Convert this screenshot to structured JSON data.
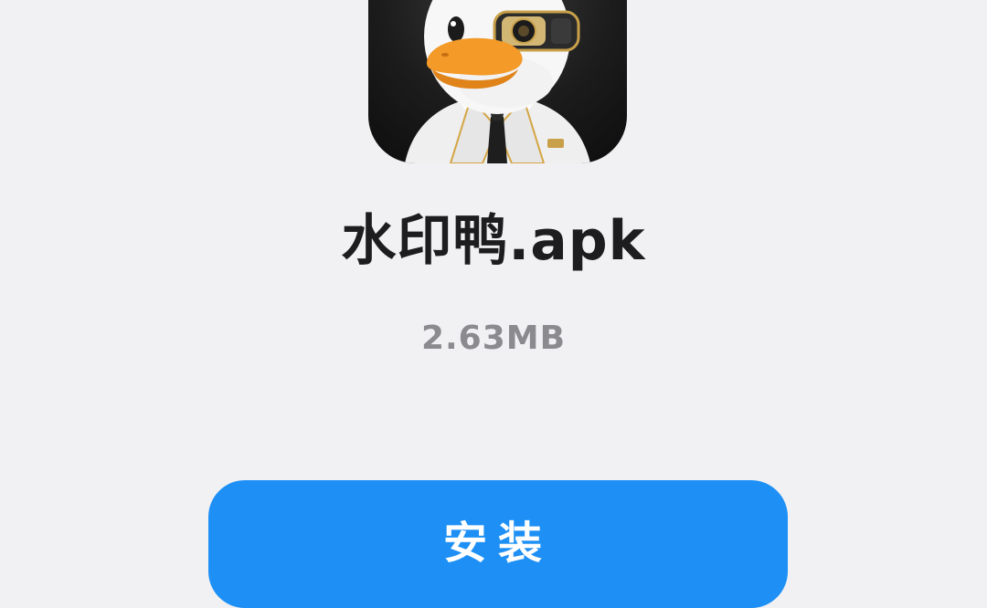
{
  "app": {
    "icon": "duck-app-icon",
    "file_name": "水印鸭.apk",
    "file_size": "2.63MB"
  },
  "actions": {
    "install_label": "安装"
  },
  "colors": {
    "background": "#f1f1f3",
    "button": "#1e90f5",
    "title": "#1d1d1f",
    "subtitle": "#8a8a8f"
  }
}
